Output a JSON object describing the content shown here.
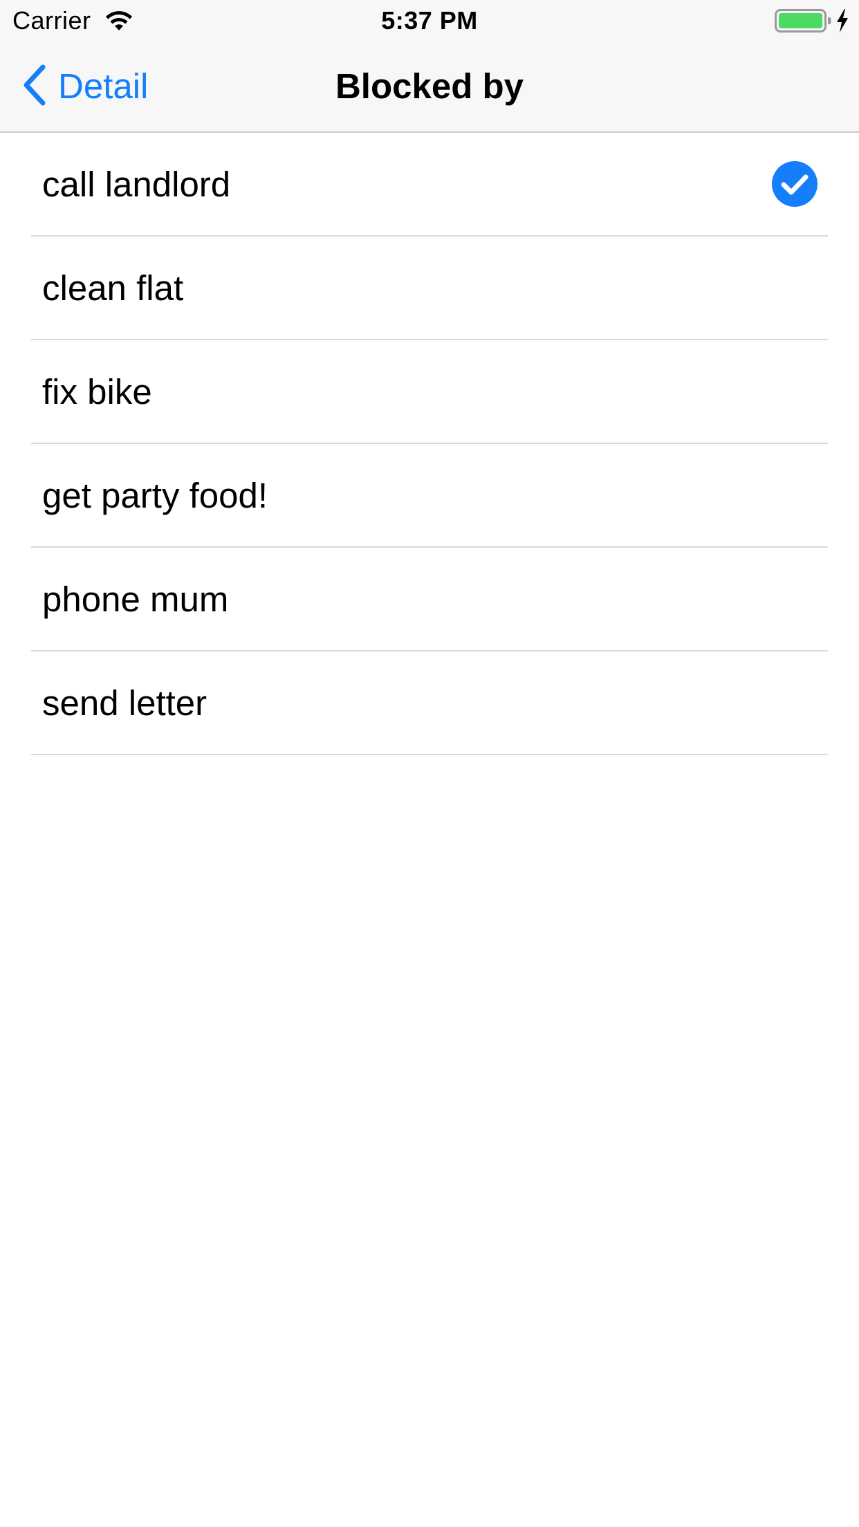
{
  "status_bar": {
    "carrier": "Carrier",
    "time": "5:37 PM",
    "icons": [
      "wifi-icon",
      "battery-icon",
      "charging-icon"
    ]
  },
  "nav_bar": {
    "back_label": "Detail",
    "back_icon": "chevron-left-icon",
    "title": "Blocked by"
  },
  "colors": {
    "accent": "#147efb",
    "bar_background": "#f7f7f7",
    "separator": "#d9d9dd",
    "battery_fill": "#4cd964"
  },
  "list": {
    "items": [
      {
        "label": "call landlord",
        "selected": true
      },
      {
        "label": "clean flat",
        "selected": false
      },
      {
        "label": "fix bike",
        "selected": false
      },
      {
        "label": "get party food!",
        "selected": false
      },
      {
        "label": "phone mum",
        "selected": false
      },
      {
        "label": "send letter",
        "selected": false
      }
    ],
    "selected_icon": "checkmark-circle-icon"
  }
}
